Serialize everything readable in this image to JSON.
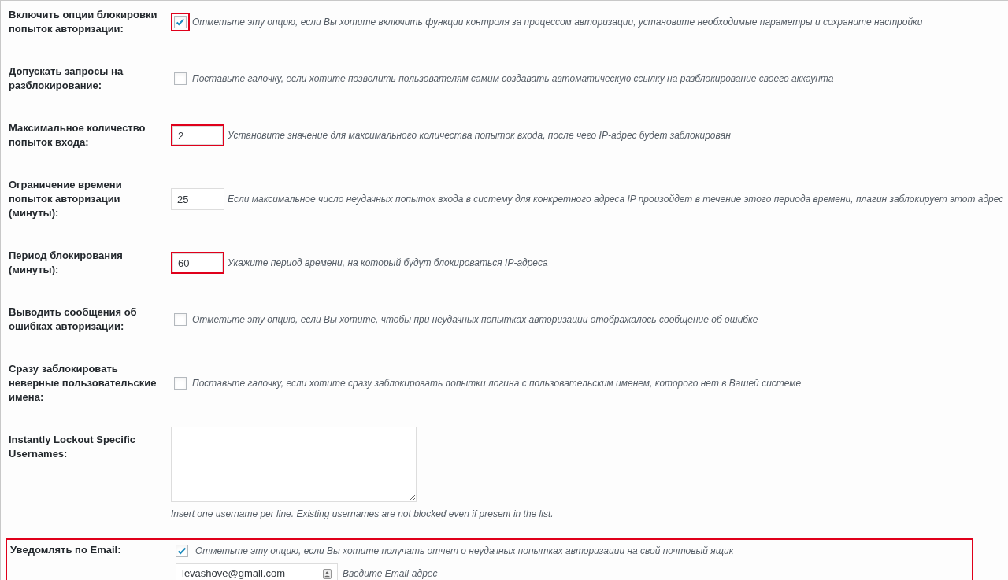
{
  "settings": [
    {
      "kind": "checkbox",
      "label": "Включить опции блокировки попыток авторизации:",
      "checked": true,
      "highlighted": true,
      "description": "Отметьте эту опцию, если Вы хотите включить функции контроля за процессом авторизации, установите необходимые параметры и сохраните настройки"
    },
    {
      "kind": "checkbox",
      "label": "Допускать запросы на разблокирование:",
      "checked": false,
      "highlighted": false,
      "description": "Поставьте галочку, если хотите позволить пользователям самим создавать автоматическую ссылку на разблокирование своего аккаунта"
    },
    {
      "kind": "number",
      "label": "Максимальное количество попыток входа:",
      "value": "2",
      "highlighted": true,
      "description": "Установите значение для максимального количества попыток входа, после чего IP-адрес будет заблокирован"
    },
    {
      "kind": "number",
      "label": "Ограничение времени попыток авторизации (минуты):",
      "value": "25",
      "highlighted": false,
      "description": "Если максимальное число неудачных попыток входа в систему для конкретного адреса IP произойдет в течение этого периода времени, плагин заблокирует этот адрес"
    },
    {
      "kind": "number",
      "label": "Период блокирования (минуты):",
      "value": "60",
      "highlighted": true,
      "description": "Укажите период времени, на который будут блокироваться IP-адреса"
    },
    {
      "kind": "checkbox",
      "label": "Выводить сообщения об ошибках авторизации:",
      "checked": false,
      "highlighted": false,
      "description": "Отметьте эту опцию, если Вы хотите, чтобы при неудачных попытках авторизации отображалось сообщение об ошибке"
    },
    {
      "kind": "checkbox",
      "label": "Сразу заблокировать неверные пользовательские имена:",
      "checked": false,
      "highlighted": false,
      "description": "Поставьте галочку, если хотите сразу заблокировать попытки логина с пользовательским именем, которого нет в Вашей системе"
    },
    {
      "kind": "textarea",
      "label": "Instantly Lockout Specific Usernames:",
      "highlighted": false,
      "description": "Insert one username per line. Existing usernames are not blocked even if present in the list."
    },
    {
      "kind": "email",
      "label": "Уведомлять по Email:",
      "checked": true,
      "value": "levashove@gmail.com",
      "highlighted": true,
      "description": "Отметьте эту опцию, если Вы хотите получать отчет о неудачных попытках авторизации на свой почтовый ящик",
      "field_hint": "Введите Email-адрес"
    }
  ]
}
